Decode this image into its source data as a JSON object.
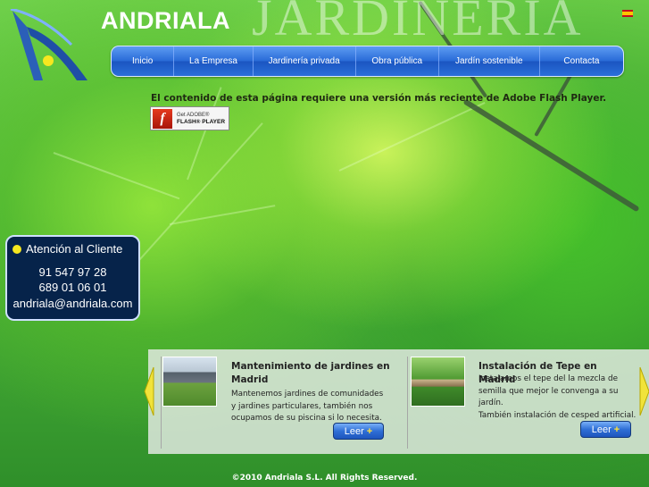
{
  "header": {
    "brand": "ANDRIALA",
    "brand_watermark": "JARDINERIA",
    "language_flag": "spain-flag-icon"
  },
  "nav": {
    "items": [
      {
        "label": "Inicio"
      },
      {
        "label": "La Empresa"
      },
      {
        "label": "Jardinería privada"
      },
      {
        "label": "Obra pública"
      },
      {
        "label": "Jardín sostenible"
      },
      {
        "label": "Contacta"
      }
    ]
  },
  "flash": {
    "message": "El contenido de esta página requiere una versión más reciente de Adobe Flash Player.",
    "button_line1": "Get ADOBE®",
    "button_line2": "FLASH® PLAYER"
  },
  "contact": {
    "title": "Atención al Cliente",
    "phone1": "91 547 97 28",
    "phone2": "689 01 06 01",
    "email": "andriala@andriala.com"
  },
  "news": [
    {
      "title_line1": "Mantenimiento de jardines en",
      "title_line2": "Madrid",
      "text_lines": [
        "Mantenemos jardines de comunidades",
        "y jardines particulares, también nos",
        "ocupamos de su piscina si lo necesita."
      ],
      "button_label": "Leer",
      "button_plus": "+"
    },
    {
      "title_line1": "Instalación de Tepe en Madrid",
      "text_lines": [
        "Instalamos el tepe del la mezcla de",
        "semilla que mejor le convenga a su",
        "jardín.",
        "También instalación de cesped artificial."
      ],
      "button_label": "Leer",
      "button_plus": "+"
    }
  ],
  "footer": {
    "copyright": "©2010 Andriala S.L. All Rights Reserved."
  },
  "colors": {
    "nav_blue": "#2a6cd8",
    "contact_bg": "#06234a",
    "accent_yellow": "#f6e71f",
    "background_green": "#6fd04a"
  }
}
